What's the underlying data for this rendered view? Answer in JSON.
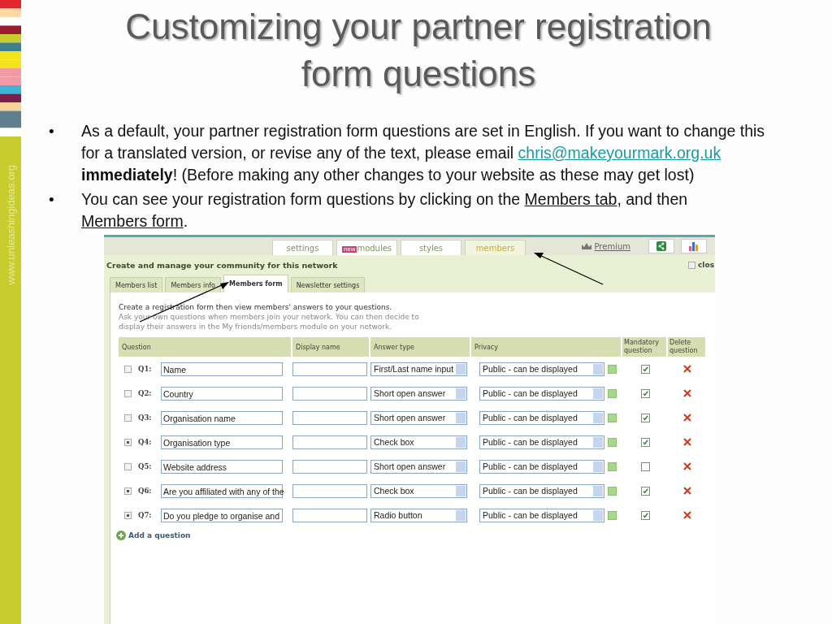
{
  "sidebar": {
    "url": "www.unleashingideas.org"
  },
  "title": "Customizing your partner registration form questions",
  "bullets": [
    {
      "bullet": "•",
      "parts": [
        {
          "kind": "text",
          "text": "As a default, your partner registration form questions are set in English.  If you want to change this for a translated version, or revise any of the text, please email "
        },
        {
          "kind": "link",
          "text": "chris@makeyourmark.org.uk"
        },
        {
          "kind": "text",
          "text": " **immediately**!  (Before making any other changes to your website as these may get lost)"
        }
      ]
    },
    {
      "bullet": "•",
      "parts": [
        {
          "kind": "text",
          "text": "You can see your registration form questions by clicking on the "
        },
        {
          "kind": "link",
          "text": "Members tab"
        },
        {
          "kind": "text",
          "text": ", and then "
        },
        {
          "kind": "link",
          "text": "Members form"
        },
        {
          "kind": "text",
          "text": "."
        }
      ]
    }
  ],
  "app": {
    "top_tabs": [
      {
        "label": "settings",
        "selected": false
      },
      {
        "label": "modules",
        "badge": "new",
        "selected": false
      },
      {
        "label": "styles",
        "selected": false
      },
      {
        "label": "members",
        "selected": true
      }
    ],
    "premium": "Premium",
    "heading": "Create and manage your community for this network",
    "close": "clos",
    "sub_tabs": [
      {
        "label": "Members list",
        "selected": false
      },
      {
        "label": "Members info",
        "selected": false
      },
      {
        "label": "Members form",
        "selected": true
      },
      {
        "label": "Newsletter settings",
        "selected": false
      }
    ],
    "intro": "Create a registration form then view members' answers to your questions.",
    "intro_hint": "Ask your own questions when members join your network. You can then decide to display their answers in the My friends/members module on your network.",
    "columns": [
      "Question",
      "Display name",
      "Answer type",
      "Privacy",
      "Mandatory question",
      "Delete question"
    ],
    "rows": [
      {
        "expandable": false,
        "number": "Q1:",
        "question": "Name",
        "answer_type": "First/Last name input",
        "privacy": "Public - can be displayed",
        "mandatory": true
      },
      {
        "expandable": false,
        "number": "Q2:",
        "question": "Country",
        "answer_type": "Short open answer",
        "privacy": "Public - can be displayed",
        "mandatory": true
      },
      {
        "expandable": false,
        "number": "Q3:",
        "question": "Organisation name",
        "answer_type": "Short open answer",
        "privacy": "Public - can be displayed",
        "mandatory": true
      },
      {
        "expandable": true,
        "number": "Q4:",
        "question": "Organisation type",
        "answer_type": "Check box",
        "privacy": "Public - can be displayed",
        "mandatory": true
      },
      {
        "expandable": false,
        "number": "Q5:",
        "question": "Website address",
        "answer_type": "Short open answer",
        "privacy": "Public - can be displayed",
        "mandatory": false
      },
      {
        "expandable": true,
        "number": "Q6:",
        "question": "Are you affiliated with any of the",
        "answer_type": "Check box",
        "privacy": "Public - can be displayed",
        "mandatory": true
      },
      {
        "expandable": true,
        "number": "Q7:",
        "question": "Do you pledge to organise and",
        "answer_type": "Radio button",
        "privacy": "Public - can be displayed",
        "mandatory": true
      }
    ],
    "add_question": "Add a question"
  }
}
